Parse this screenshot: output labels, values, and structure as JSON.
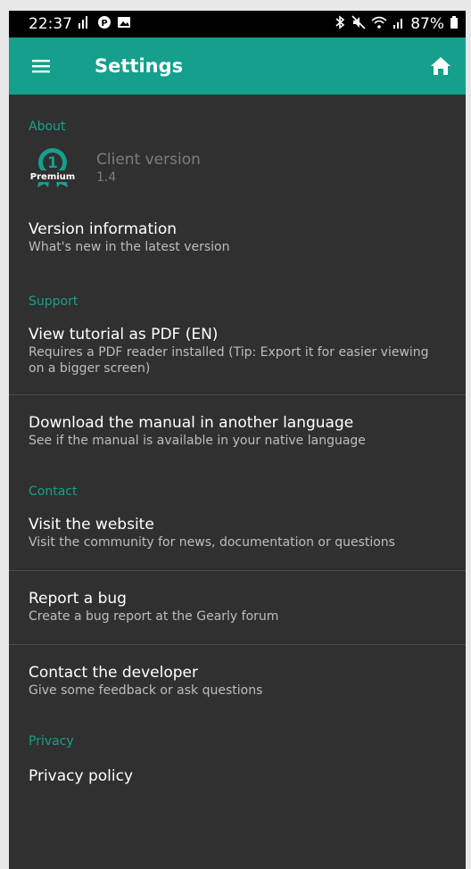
{
  "status_bar": {
    "time": "22:37",
    "battery": "87%"
  },
  "app_bar": {
    "title": "Settings",
    "menu_icon": "hamburger-menu-icon",
    "home_icon": "home-icon"
  },
  "sections": {
    "about": {
      "header": "About",
      "badge_text": "Premium",
      "badge_number": "1",
      "client_version_label": "Client version",
      "client_version_value": "1.4",
      "version_info_title": "Version information",
      "version_info_sub": "What's new in the latest version"
    },
    "support": {
      "header": "Support",
      "tutorial_title": "View tutorial as PDF (EN)",
      "tutorial_sub": "Requires a PDF reader installed (Tip: Export it for easier viewing on a bigger screen)",
      "manual_title": "Download the manual in another language",
      "manual_sub": "See if the manual is available in your native language"
    },
    "contact": {
      "header": "Contact",
      "website_title": "Visit the website",
      "website_sub": "Visit the community for news, documentation or questions",
      "bug_title": "Report a bug",
      "bug_sub": "Create a bug report at the Gearly forum",
      "developer_title": "Contact the developer",
      "developer_sub": "Give some feedback or ask questions"
    },
    "privacy": {
      "header": "Privacy",
      "policy_title": "Privacy policy"
    }
  },
  "colors": {
    "accent": "#14a08c",
    "background": "#303030",
    "section_header": "#16a08b"
  }
}
